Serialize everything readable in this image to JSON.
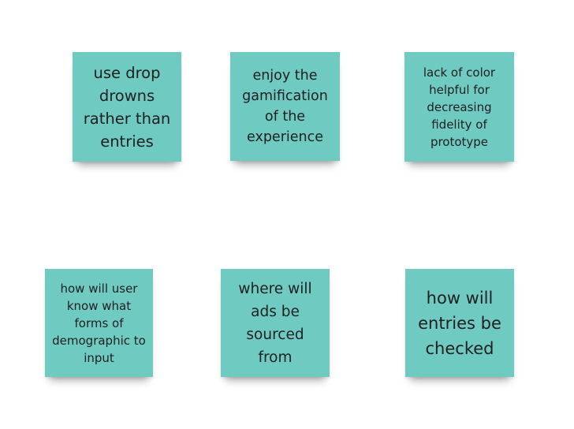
{
  "board": {
    "note_color": "#6fcac2",
    "notes": [
      {
        "text": "use drop drowns rather than entries"
      },
      {
        "text": "enjoy the gamification of the experience"
      },
      {
        "text": "lack of color helpful for decreasing fidelity of prototype"
      },
      {
        "text": "how will user know what forms of demographic to input"
      },
      {
        "text": "where will ads be sourced from"
      },
      {
        "text": "how will entries be checked"
      }
    ]
  }
}
